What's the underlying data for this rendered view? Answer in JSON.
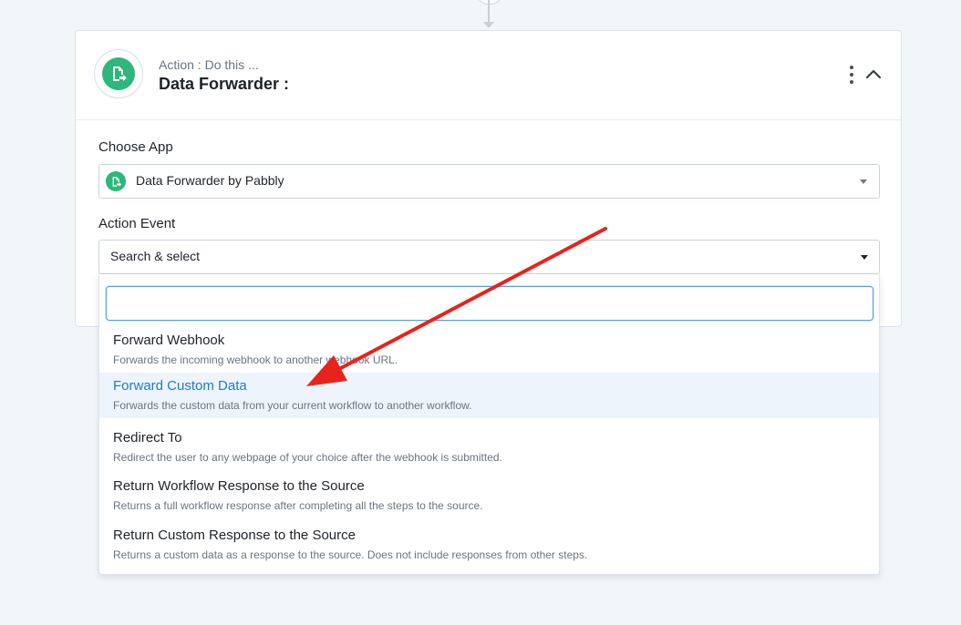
{
  "header": {
    "action_label": "Action : Do this ...",
    "title": "Data Forwarder :"
  },
  "choose_app": {
    "label": "Choose App",
    "selected": "Data Forwarder by Pabbly"
  },
  "action_event": {
    "label": "Action Event",
    "placeholder": "Search & select",
    "search_value": ""
  },
  "options": [
    {
      "title": "Forward Webhook",
      "desc": "Forwards the incoming webhook to another webhook URL."
    },
    {
      "title": "Forward Custom Data",
      "desc": "Forwards the custom data from your current workflow to another workflow."
    },
    {
      "title": "Redirect To",
      "desc": "Redirect the user to any webpage of your choice after the webhook is submitted."
    },
    {
      "title": "Return Workflow Response to the Source",
      "desc": "Returns a full workflow response after completing all the steps to the source."
    },
    {
      "title": "Return Custom Response to the Source",
      "desc": "Returns a custom data as a response to the source. Does not include responses from other steps."
    }
  ],
  "active_option_index": 1,
  "colors": {
    "brand_green": "#2db77b",
    "active_blue": "#1a7bd6",
    "annotation_red": "#e8231c"
  },
  "icons": {
    "app": "data-forwarder-icon",
    "more": "more-vertical-icon",
    "collapse": "chevron-up-icon",
    "dropdown": "caret-down-icon"
  }
}
